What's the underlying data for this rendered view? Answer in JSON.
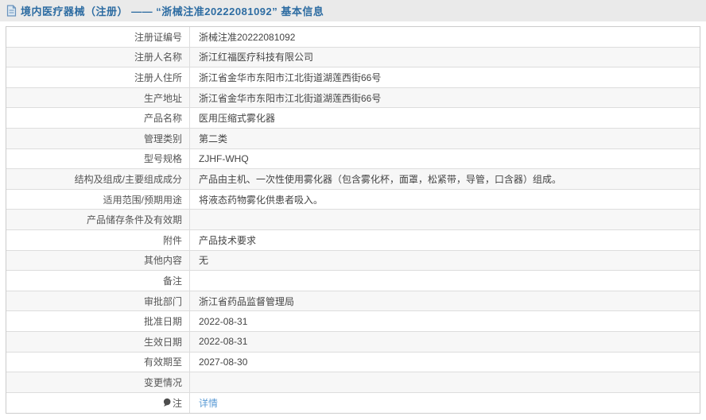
{
  "header": {
    "icon": "document-icon",
    "title": "境内医疗器械（注册） —— “浙械注准20222081092” 基本信息"
  },
  "colors": {
    "header_band_bg": "#eaeaea",
    "header_text": "#2d6ca2",
    "link": "#5b9bd5",
    "row_alt_bg": "#f7f7f7",
    "border_outer": "#cccccc",
    "border_inner": "#dddddd",
    "label_text": "#555555",
    "value_text": "#444444"
  },
  "table": {
    "rows": [
      {
        "label": "注册证编号",
        "value": "浙械注准20222081092"
      },
      {
        "label": "注册人名称",
        "value": "浙江红福医疗科技有限公司"
      },
      {
        "label": "注册人住所",
        "value": "浙江省金华市东阳市江北街道湖莲西街66号"
      },
      {
        "label": "生产地址",
        "value": "浙江省金华市东阳市江北街道湖莲西街66号"
      },
      {
        "label": "产品名称",
        "value": "医用压缩式雾化器"
      },
      {
        "label": "管理类别",
        "value": "第二类"
      },
      {
        "label": "型号规格",
        "value": "ZJHF-WHQ"
      },
      {
        "label": "结构及组成/主要组成成分",
        "value": "产品由主机、一次性使用雾化器（包含雾化杯，面罩，松紧带，导管，口含器）组成。"
      },
      {
        "label": "适用范围/预期用途",
        "value": "将液态药物雾化供患者吸入。"
      },
      {
        "label": "产品储存条件及有效期",
        "value": ""
      },
      {
        "label": "附件",
        "value": "产品技术要求"
      },
      {
        "label": "其他内容",
        "value": "无"
      },
      {
        "label": "备注",
        "value": ""
      },
      {
        "label": "审批部门",
        "value": "浙江省药品监督管理局"
      },
      {
        "label": "批准日期",
        "value": "2022-08-31"
      },
      {
        "label": "生效日期",
        "value": "2022-08-31"
      },
      {
        "label": "有效期至",
        "value": "2027-08-30"
      },
      {
        "label": "变更情况",
        "value": ""
      },
      {
        "label": "注",
        "value": "详情",
        "label_icon": "pin-icon",
        "value_is_link": true
      }
    ]
  }
}
